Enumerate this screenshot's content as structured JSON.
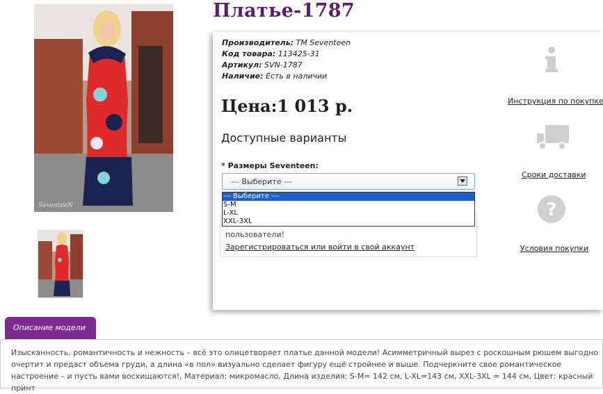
{
  "product": {
    "title": "Платье-1787",
    "specs": [
      {
        "label": "Производитель:",
        "value": "ТМ Seventeen"
      },
      {
        "label": "Код товара:",
        "value": "113425-31"
      },
      {
        "label": "Артикул:",
        "value": "SVN-1787"
      },
      {
        "label": "Наличие:",
        "value": "Есть в наличии"
      }
    ],
    "price": "Цена:1 013 р.",
    "variants_heading": "Доступные варианты",
    "size_required_mark": "*",
    "size_label": "Размеры Seventeen:",
    "size_select": {
      "selected": "--- Выберите ---",
      "options": [
        "--- Выберите ---",
        "S-M",
        "L-XL",
        "XXL-3XL"
      ],
      "highlighted_index": 0
    },
    "login_message": "пользователи!",
    "login_link": "Зарегистрироваться или войти в свой аккаунт",
    "photo_watermark": "SeventeeN"
  },
  "sidebar": {
    "items": [
      {
        "icon": "info-icon",
        "label": "Инструкция по покупке"
      },
      {
        "icon": "truck-icon",
        "label": "Сроки доставки"
      },
      {
        "icon": "question-icon",
        "label": "Условия покупки"
      }
    ]
  },
  "description": {
    "tab_label": "Описание модели",
    "text": "Изысканность, романтичность и нежность – всё это олицетворяет платье данной модели! Асимметричный вырез с роскошным рюшем выгодно очертит и предаст объема груди, а длина «в пол» визуально сделает фигуру ещё стройнее и выше. Подчеркните свое романтическое настроение – и пусть вами восхищаются!, Материал: микромасло, Длина изделия: S-M= 142 см, L-XL=143 см, XXL-3XL = 144 см, Цвет: красный принт"
  },
  "colors": {
    "title": "#5a1e6e",
    "tab": "#7d2b8e",
    "select_highlight": "#1e5fcf"
  }
}
